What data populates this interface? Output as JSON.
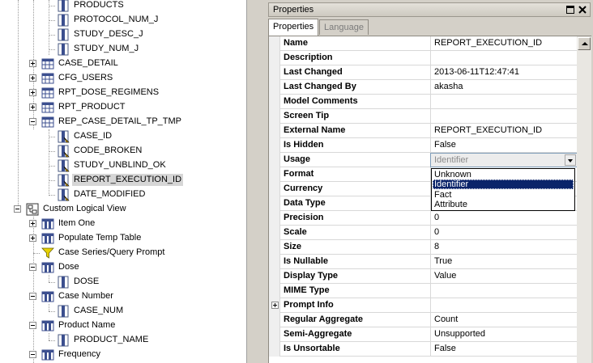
{
  "tree": {
    "nodes": [
      {
        "label": "PRODUCTS",
        "icon": "column-icon"
      },
      {
        "label": "PROTOCOL_NUM_J",
        "icon": "column-icon"
      },
      {
        "label": "STUDY_DESC_J",
        "icon": "column-icon"
      },
      {
        "label": "STUDY_NUM_J",
        "icon": "column-icon"
      },
      {
        "label": "CASE_DETAIL",
        "icon": "table-icon"
      },
      {
        "label": "CFG_USERS",
        "icon": "table-icon"
      },
      {
        "label": "RPT_DOSE_REGIMENS",
        "icon": "table-icon"
      },
      {
        "label": "RPT_PRODUCT",
        "icon": "table-icon"
      },
      {
        "label": "REP_CASE_DETAIL_TP_TMP",
        "icon": "table-icon"
      },
      {
        "label": "CASE_ID",
        "icon": "key-column-icon"
      },
      {
        "label": "CODE_BROKEN",
        "icon": "key-column-icon"
      },
      {
        "label": "STUDY_UNBLIND_OK",
        "icon": "key-column-icon"
      },
      {
        "label": "REPORT_EXECUTION_ID",
        "icon": "key-column-icon"
      },
      {
        "label": "DATE_MODIFIED",
        "icon": "key-column-icon"
      },
      {
        "label": "Custom Logical View",
        "icon": "logical-view-icon"
      },
      {
        "label": "Item One",
        "icon": "item-icon"
      },
      {
        "label": "Populate Temp Table",
        "icon": "item-icon"
      },
      {
        "label": "Case Series/Query Prompt",
        "icon": "filter-icon"
      },
      {
        "label": "Dose",
        "icon": "item-icon"
      },
      {
        "label": "DOSE",
        "icon": "column-icon"
      },
      {
        "label": "Case Number",
        "icon": "item-icon"
      },
      {
        "label": "CASE_NUM",
        "icon": "column-icon"
      },
      {
        "label": "Product Name",
        "icon": "item-icon"
      },
      {
        "label": "PRODUCT_NAME",
        "icon": "column-icon"
      },
      {
        "label": "Frequency",
        "icon": "item-icon"
      }
    ]
  },
  "properties_panel": {
    "title": "Properties",
    "tabs": [
      {
        "label": "Properties",
        "active": true
      },
      {
        "label": "Language",
        "active": false
      }
    ],
    "rows": [
      {
        "name": "Name",
        "value": "REPORT_EXECUTION_ID"
      },
      {
        "name": "Description",
        "value": ""
      },
      {
        "name": "Last Changed",
        "value": "2013-06-11T12:47:41"
      },
      {
        "name": "Last Changed By",
        "value": "akasha"
      },
      {
        "name": "Model Comments",
        "value": ""
      },
      {
        "name": "Screen Tip",
        "value": ""
      },
      {
        "name": "External Name",
        "value": "REPORT_EXECUTION_ID"
      },
      {
        "name": "Is Hidden",
        "value": "False"
      },
      {
        "name": "Usage",
        "value": "Identifier"
      },
      {
        "name": "Format",
        "value": ""
      },
      {
        "name": "Currency",
        "value": ""
      },
      {
        "name": "Data Type",
        "value": ""
      },
      {
        "name": "Precision",
        "value": "0"
      },
      {
        "name": "Scale",
        "value": "0"
      },
      {
        "name": "Size",
        "value": "8"
      },
      {
        "name": "Is Nullable",
        "value": "True"
      },
      {
        "name": "Display Type",
        "value": "Value"
      },
      {
        "name": "MIME Type",
        "value": ""
      },
      {
        "name": "Prompt Info",
        "value": ""
      },
      {
        "name": "Regular Aggregate",
        "value": "Count"
      },
      {
        "name": "Semi-Aggregate",
        "value": "Unsupported"
      },
      {
        "name": "Is Unsortable",
        "value": "False"
      }
    ],
    "usage_dropdown": {
      "options": [
        "Unknown",
        "Identifier",
        "Fact",
        "Attribute"
      ],
      "selected": "Identifier"
    }
  },
  "colors": {
    "selection_highlight": "#0a246a",
    "tree_selection": "#d6d6d6",
    "panel_background": "#d4d0c8",
    "disabled_text": "#8b8b8b"
  }
}
